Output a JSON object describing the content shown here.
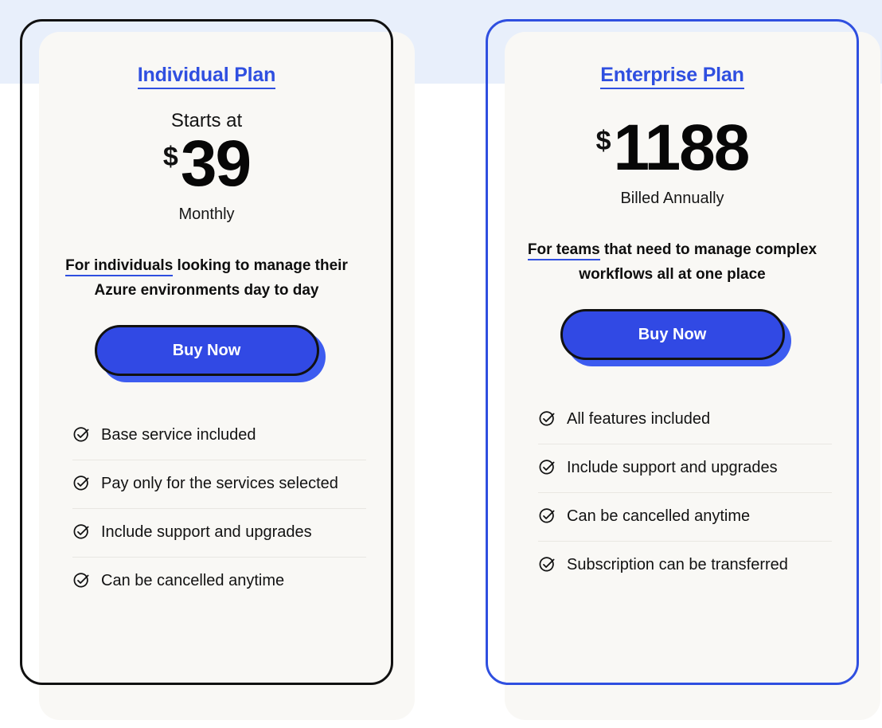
{
  "theme": {
    "accent_blue": "#2F4FE0",
    "button_blue": "#3149E4",
    "band_blue": "#E8EFFB",
    "card_cream": "#F9F8F5",
    "outline_black": "#111111",
    "divider_gray": "#E9E7E2"
  },
  "plans": [
    {
      "id": "individual",
      "title": "Individual Plan",
      "border_color": "#111111",
      "price_lead": "Starts at",
      "currency": "$",
      "amount": "39",
      "price_caption": "Monthly",
      "desc_highlight": "For individuals",
      "desc_rest": " looking to manage their Azure environments day to day",
      "cta_label": "Buy Now",
      "features": [
        "Base service included",
        "Pay only for the services selected",
        "Include support and upgrades",
        "Can be cancelled anytime"
      ]
    },
    {
      "id": "enterprise",
      "title": "Enterprise Plan",
      "border_color": "#2F4FE0",
      "price_lead": "",
      "currency": "$",
      "amount": "1188",
      "price_caption": "Billed Annually",
      "desc_highlight": "For teams",
      "desc_rest": " that need to manage complex workflows all at one place",
      "cta_label": "Buy Now",
      "features": [
        "All features included",
        "Include support and upgrades",
        "Can be cancelled anytime",
        "Subscription can be transferred"
      ]
    }
  ]
}
